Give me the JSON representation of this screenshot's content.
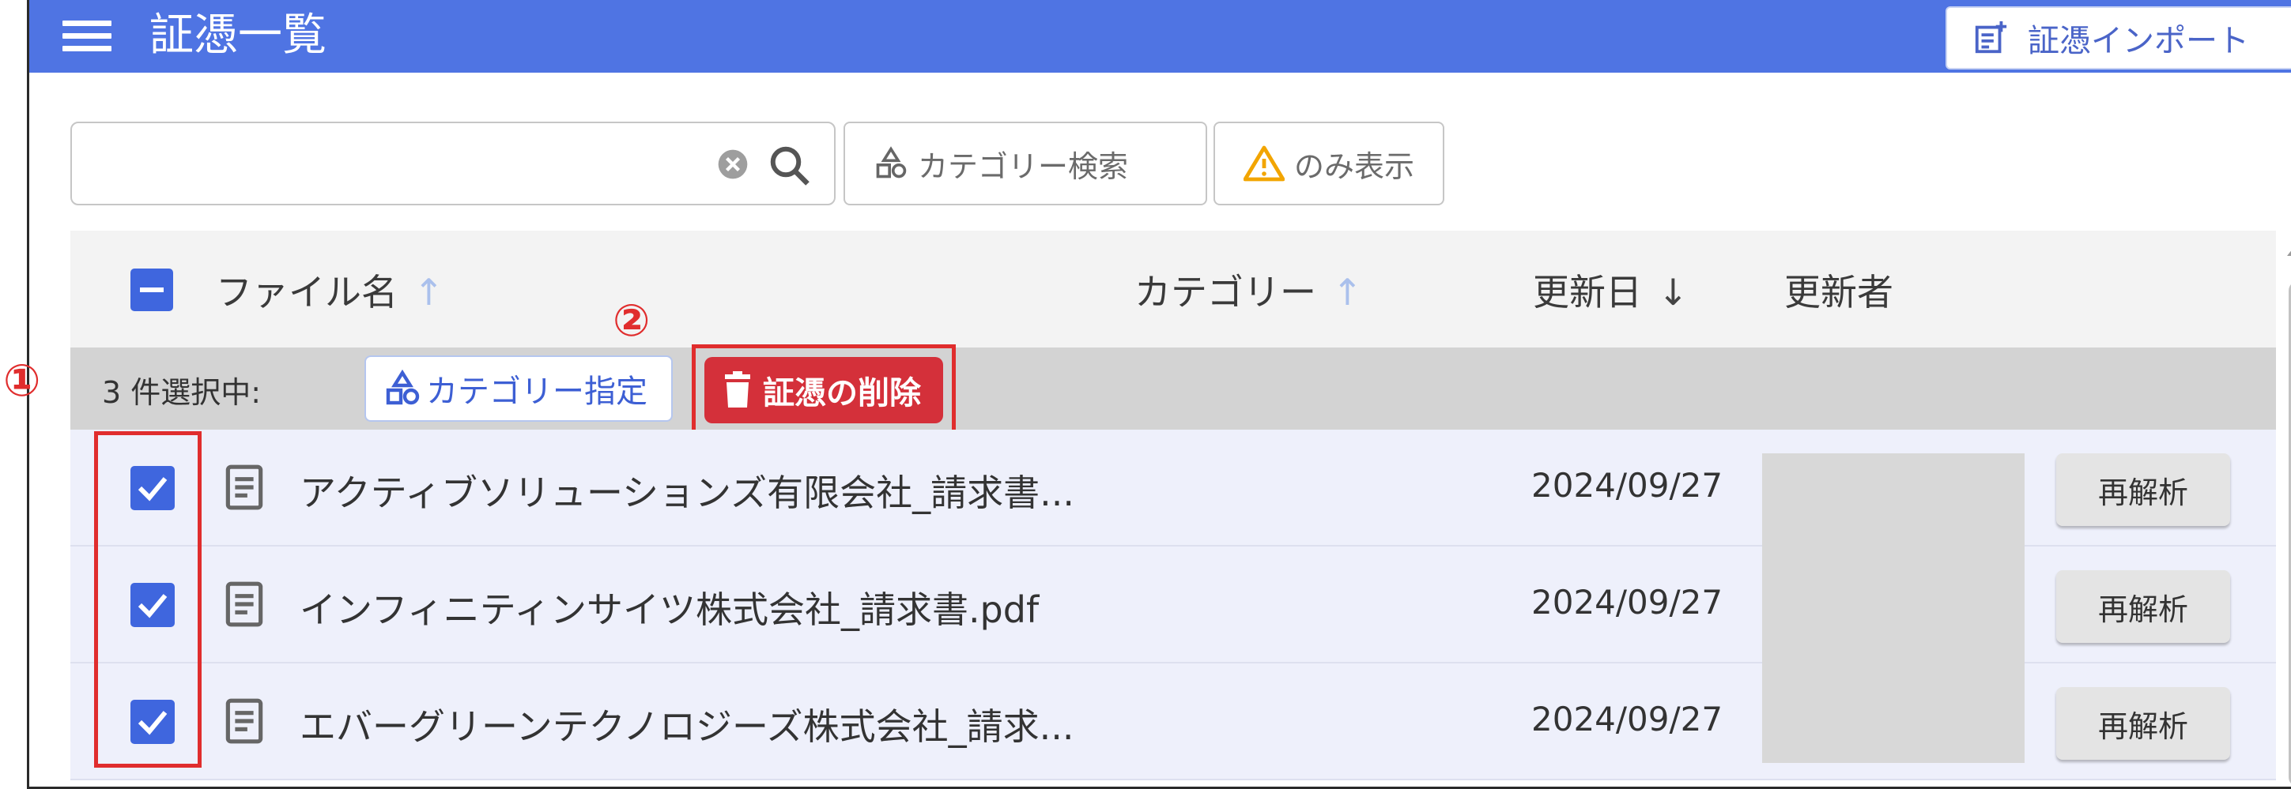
{
  "header": {
    "title": "証憑一覧",
    "import_label": "証憑インポート"
  },
  "search": {
    "value": "",
    "category_search_label": "カテゴリー検索",
    "warning_only_label": "のみ表示"
  },
  "table": {
    "columns": {
      "file_name": "ファイル名",
      "file_name_sort": "↑",
      "category": "カテゴリー",
      "category_sort": "↑",
      "updated_date": "更新日",
      "updated_date_sort": "↓",
      "updated_by": "更新者"
    },
    "selection": {
      "count_text": "3 件選択中:",
      "assign_category_label": "カテゴリー指定",
      "delete_label": "証憑の削除"
    },
    "rows": [
      {
        "file_name": "アクティブソリューションズ有限会社_請求書...",
        "updated_date": "2024/09/27",
        "action_label": "再解析"
      },
      {
        "file_name": "インフィニティンサイツ株式会社_請求書.pdf",
        "updated_date": "2024/09/27",
        "action_label": "再解析"
      },
      {
        "file_name": "エバーグリーンテクノロジーズ株式会社_請求...",
        "updated_date": "2024/09/27",
        "action_label": "再解析"
      }
    ]
  },
  "annotations": {
    "marker_1": "①",
    "marker_2": "②"
  },
  "colors": {
    "appbar": "#4f74e3",
    "checkbox": "#3f66de",
    "delete": "#d4303a",
    "highlight": "#e02d2d"
  }
}
